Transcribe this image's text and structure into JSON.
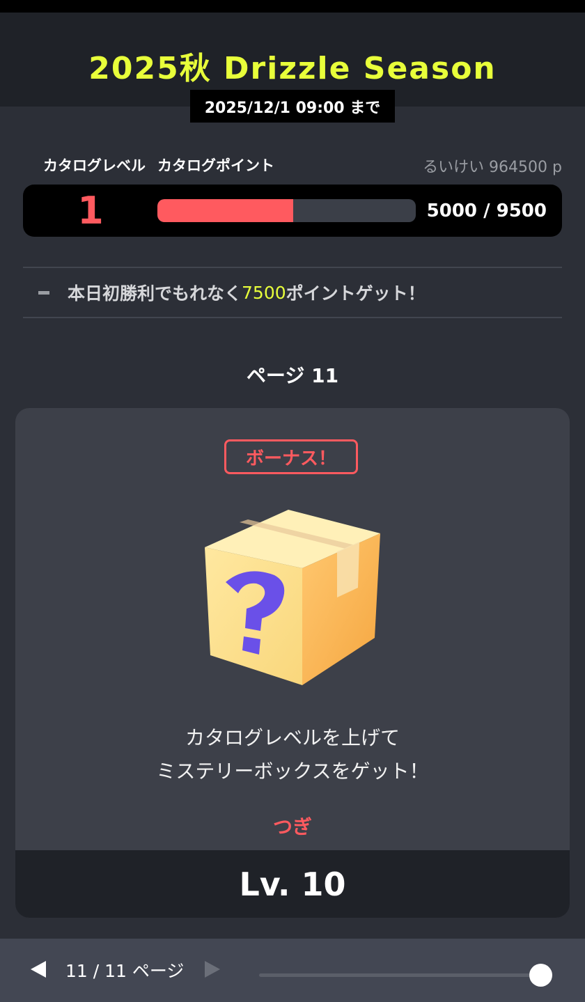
{
  "season": {
    "title": "2025秋 Drizzle Season",
    "deadline": "2025/12/1 09:00 まで"
  },
  "catalog": {
    "level_label": "カタログレベル",
    "point_label": "カタログポイント",
    "cumulative": "るいけい 964500 p",
    "level": "1",
    "points_current": "5000",
    "points_separator": " / ",
    "points_max": "9500",
    "progress_fraction": 0.526
  },
  "notice": {
    "prefix": "本日初勝利でもれなく",
    "highlight": "7500",
    "suffix": "ポイントゲット！"
  },
  "page": {
    "heading": "ページ 11",
    "badge": "ボーナス！",
    "message_line1": "カタログレベルを上げて",
    "message_line2": "ミステリーボックスをゲット！",
    "next_label": "つぎ",
    "next_level": "Lv. 10"
  },
  "footer": {
    "page_indicator": "11 / 11 ページ",
    "slider_fraction": 1.0
  },
  "colors": {
    "accent_yellow": "#e8ff3a",
    "accent_red": "#ff5a5f",
    "background": "#2c2f37",
    "card": "#3d4049"
  },
  "icons": {
    "prev": "triangle-left-icon",
    "next": "triangle-right-icon",
    "box": "mystery-box-icon"
  }
}
